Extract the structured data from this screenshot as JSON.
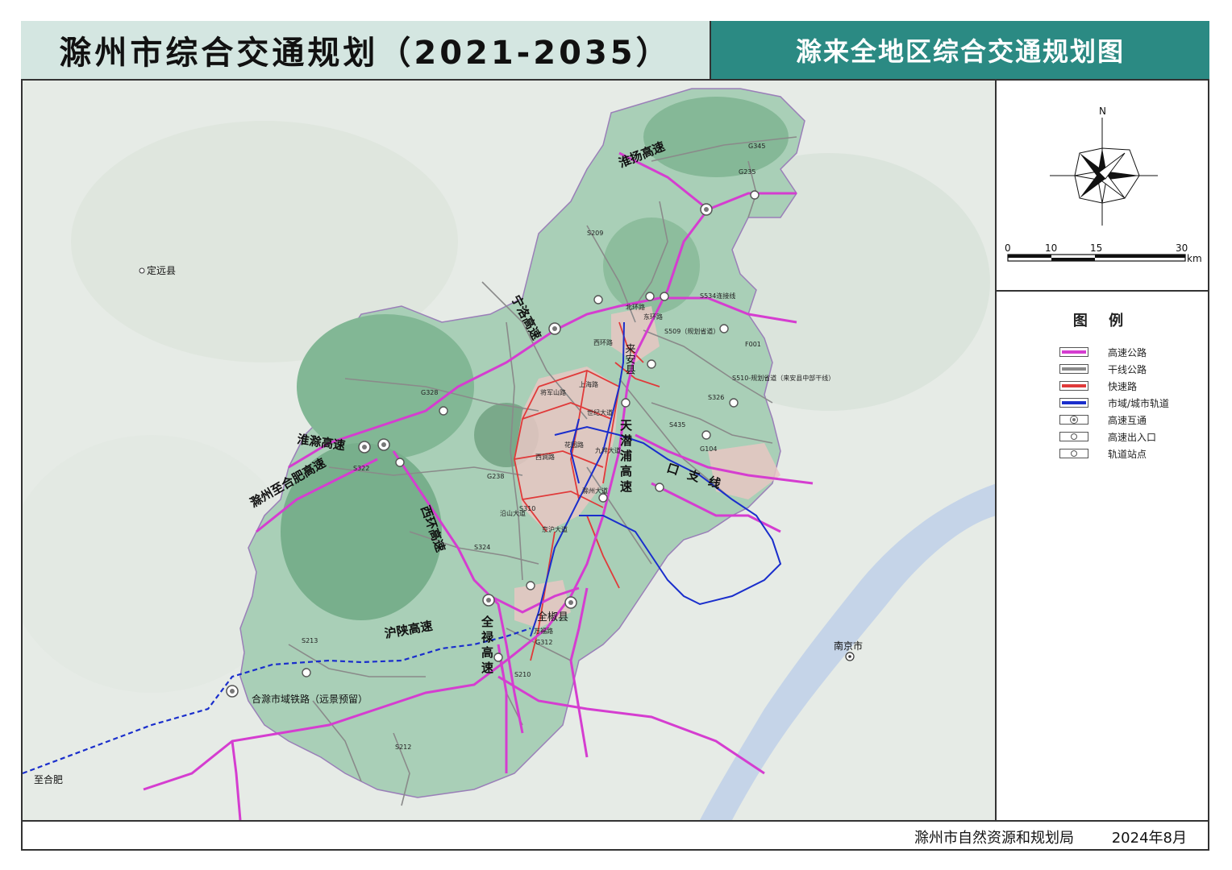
{
  "header": {
    "main_title": "滁州市综合交通规划（2021-2035）",
    "sub_title": "滁来全地区综合交通规划图"
  },
  "compass": {
    "north_label": "N"
  },
  "scale_bar": {
    "ticks": [
      "0",
      "10",
      "15",
      "30"
    ],
    "unit": "km"
  },
  "legend": {
    "title": "图 例",
    "items": [
      {
        "label": "高速公路",
        "color": "#d53dd0",
        "type": "line"
      },
      {
        "label": "干线公路",
        "color": "#8a8a8a",
        "type": "line"
      },
      {
        "label": "快速路",
        "color": "#e03a3a",
        "type": "line"
      },
      {
        "label": "市域/城市轨道",
        "color": "#1a2ecc",
        "type": "line"
      },
      {
        "label": "高速互通",
        "type": "interchange"
      },
      {
        "label": "高速出入口",
        "type": "exit"
      },
      {
        "label": "轨道站点",
        "type": "station"
      }
    ]
  },
  "map": {
    "expressway_labels": {
      "huaiyang": "淮扬高速",
      "ningluo": "宁洛高速",
      "huaichu": "淮滁高速",
      "chuhefei": "滁州至合肥高速",
      "xihuan": "西环高速",
      "hushaan": "沪陕高速",
      "tianqianpu": "天潜浦高速",
      "pukou": "口支线",
      "quanlu": "全禄高速"
    },
    "city_labels": {
      "laian": "来安县",
      "quanjiao": "全椒县",
      "nanjing": "南京市",
      "dingyuan": "定远县"
    },
    "road_labels": {
      "beihuan": "北环路",
      "donghuan": "东环路",
      "xihuan_rd": "西环路",
      "shanghai": "上海路",
      "shiji": "世纪大道",
      "jiangping": "将军山路",
      "huashan": "花园路",
      "jiuyang": "九梓大道",
      "chuzhou": "滁州大道",
      "xijiang": "西涧路",
      "yanshan": "沿山大道",
      "jinghu": "京沪大道",
      "wanfu": "万福路",
      "g345": "G345",
      "g235": "G235",
      "s209": "S209",
      "s534": "S534连接线",
      "s509": "S509（规划省道）",
      "f001": "F001",
      "s510": "S510-规划省道（来安县中部干线）",
      "s326": "S326",
      "s435": "S435",
      "g104": "G104",
      "g328": "G328",
      "g238": "G238",
      "s322": "S322",
      "s324": "S324",
      "s310": "S310",
      "s213": "S213",
      "g312": "G312",
      "s210": "S210",
      "s212": "S212"
    },
    "rail_labels": {
      "hechu": "合滁市域铁路（远景预留）",
      "zhihefei": "至合肥"
    }
  },
  "footer": {
    "organization": "滁州市自然资源和规划局",
    "date": "2024年8月"
  }
}
